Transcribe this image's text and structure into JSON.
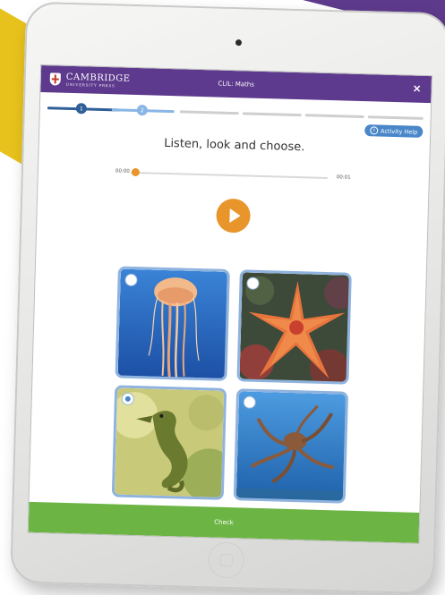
{
  "header": {
    "logo_main": "CAMBRIDGE",
    "logo_sub": "UNIVERSITY PRESS",
    "title": "CLIL: Maths",
    "close_label": "×"
  },
  "progress": {
    "steps": [
      "1",
      "2"
    ],
    "current_step": 2
  },
  "help": {
    "label": "Activity Help",
    "icon_glyph": "?"
  },
  "question": {
    "instruction": "Listen, look and choose."
  },
  "audio": {
    "current_time": "00:00",
    "duration": "00:01"
  },
  "options": [
    {
      "subject": "jellyfish",
      "selected": false
    },
    {
      "subject": "starfish",
      "selected": false
    },
    {
      "subject": "seahorse",
      "selected": true
    },
    {
      "subject": "octopus",
      "selected": false
    }
  ],
  "footer": {
    "check_label": "Check"
  },
  "colors": {
    "header": "#5d3a8d",
    "accent_orange": "#e8962c",
    "progress_blue": "#2f5f98",
    "help_blue": "#4a87c9",
    "check_green": "#6cb544"
  }
}
